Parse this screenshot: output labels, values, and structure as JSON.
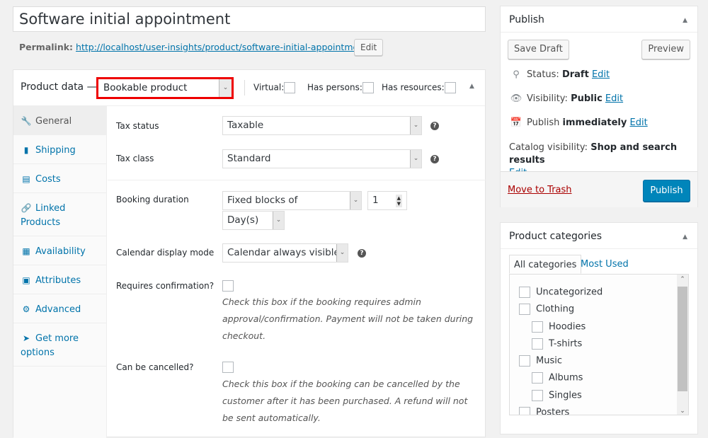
{
  "post": {
    "title": "Software initial appointment",
    "permalink_label": "Permalink:",
    "permalink_url": "http://localhost/user-insights/product/software-initial-appointment/",
    "permalink_edit": "Edit"
  },
  "product_data": {
    "title": "Product data —",
    "type_selected": "Bookable product",
    "virtual_label": "Virtual:",
    "has_persons_label": "Has persons:",
    "has_resources_label": "Has resources:",
    "virtual_checked": false,
    "has_persons_checked": false,
    "has_resources_checked": false,
    "tabs": [
      {
        "label": "General",
        "icon": "wrench-icon",
        "active": true
      },
      {
        "label": "Shipping",
        "icon": "truck-icon",
        "active": false
      },
      {
        "label": "Costs",
        "icon": "money-icon",
        "active": false
      },
      {
        "label": "Linked Products",
        "icon": "link-icon",
        "active": false
      },
      {
        "label": "Availability",
        "icon": "calendar-icon",
        "active": false
      },
      {
        "label": "Attributes",
        "icon": "list-icon",
        "active": false
      },
      {
        "label": "Advanced",
        "icon": "gear-icon",
        "active": false
      },
      {
        "label": "Get more options",
        "icon": "plug-icon",
        "active": false
      }
    ],
    "fields": {
      "tax_status": {
        "label": "Tax status",
        "value": "Taxable"
      },
      "tax_class": {
        "label": "Tax class",
        "value": "Standard"
      },
      "booking_duration": {
        "label": "Booking duration",
        "type_value": "Fixed blocks of",
        "quantity": "1",
        "unit_value": "Day(s)"
      },
      "calendar_display_mode": {
        "label": "Calendar display mode",
        "value": "Calendar always visible"
      },
      "requires_confirmation": {
        "label": "Requires confirmation?",
        "checked": false,
        "description": "Check this box if the booking requires admin approval/confirmation. Payment will not be taken during checkout."
      },
      "can_be_cancelled": {
        "label": "Can be cancelled?",
        "checked": false,
        "description": "Check this box if the booking can be cancelled by the customer after it has been purchased. A refund will not be sent automatically."
      }
    }
  },
  "publish": {
    "title": "Publish",
    "save_draft": "Save Draft",
    "preview": "Preview",
    "status_label": "Status:",
    "status_value": "Draft",
    "visibility_label": "Visibility:",
    "visibility_value": "Public",
    "publish_label": "Publish",
    "publish_value": "immediately",
    "catalog_label": "Catalog visibility:",
    "catalog_value": "Shop and search results",
    "edit": "Edit",
    "move_to_trash": "Move to Trash",
    "publish_button": "Publish"
  },
  "categories": {
    "title": "Product categories",
    "tab_all": "All categories",
    "tab_most_used": "Most Used",
    "items": [
      {
        "label": "Uncategorized",
        "level": 0,
        "checked": false
      },
      {
        "label": "Clothing",
        "level": 0,
        "checked": false
      },
      {
        "label": "Hoodies",
        "level": 1,
        "checked": false
      },
      {
        "label": "T-shirts",
        "level": 1,
        "checked": false
      },
      {
        "label": "Music",
        "level": 0,
        "checked": false
      },
      {
        "label": "Albums",
        "level": 1,
        "checked": false
      },
      {
        "label": "Singles",
        "level": 1,
        "checked": false
      },
      {
        "label": "Posters",
        "level": 0,
        "checked": false
      }
    ]
  },
  "colors": {
    "link": "#0073aa",
    "primary_button": "#0085ba",
    "highlight_border": "#ee0000",
    "trash": "#aa0000"
  }
}
